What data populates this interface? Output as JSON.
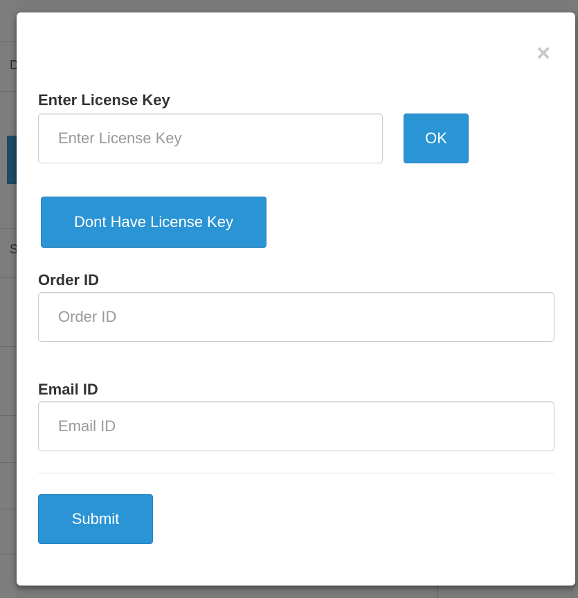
{
  "background": {
    "letters": [
      "D",
      "S"
    ]
  },
  "modal": {
    "close_symbol": "×",
    "license": {
      "label": "Enter License Key",
      "placeholder": "Enter License Key",
      "ok_label": "OK"
    },
    "no_key_label": "Dont Have License Key",
    "order": {
      "label": "Order ID",
      "placeholder": "Order ID"
    },
    "email": {
      "label": "Email ID",
      "placeholder": "Email ID"
    },
    "submit_label": "Submit"
  },
  "colors": {
    "primary": "#2a94d4",
    "overlay": "#7a7a7a"
  }
}
